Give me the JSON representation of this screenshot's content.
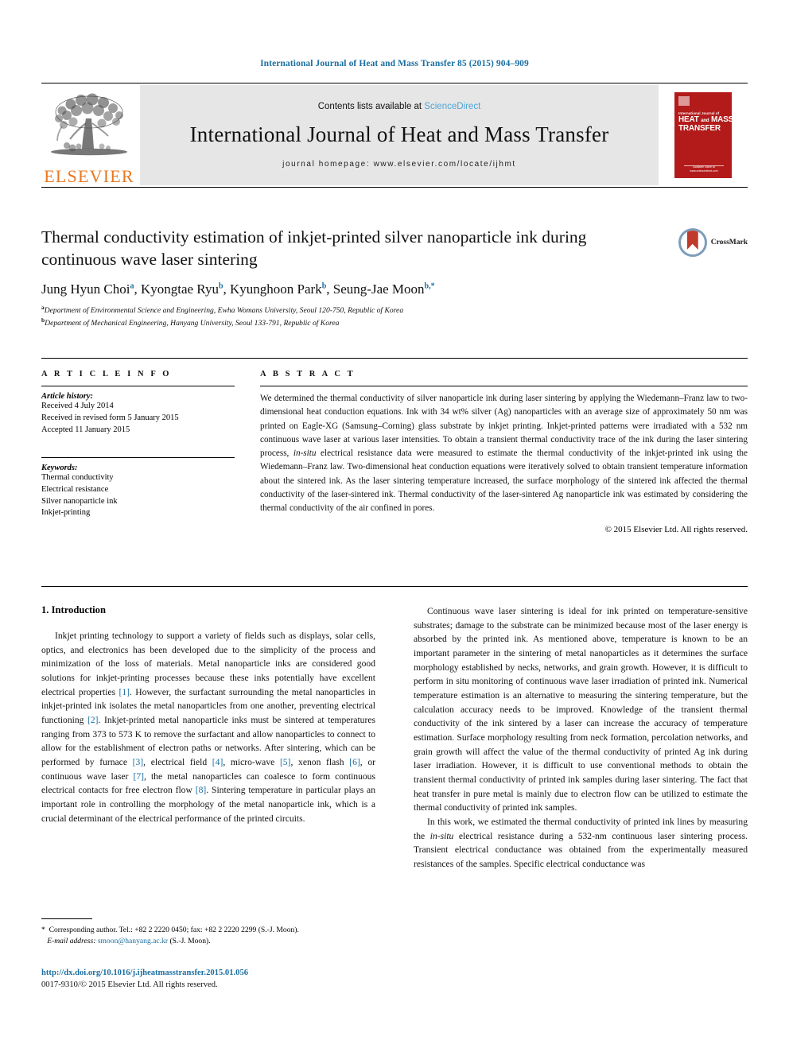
{
  "running_head": "International Journal of Heat and Mass Transfer 85 (2015) 904–909",
  "masthead": {
    "publisher": "ELSEVIER",
    "contents_prefix": "Contents lists available at ",
    "contents_link": "ScienceDirect",
    "journal_title": "International Journal of Heat and Mass Transfer",
    "homepage": "journal homepage: www.elsevier.com/locate/ijhmt",
    "cover": {
      "small_line": "International Journal of",
      "title_line1": "HEAT",
      "title_and": "and",
      "title_line2": "MASS",
      "title_line3": "TRANSFER",
      "foot_line": "Available online at www.sciencedirect.com"
    }
  },
  "article": {
    "title": "Thermal conductivity estimation of inkjet-printed silver nanoparticle ink during continuous wave laser sintering",
    "crossmark_label": "CrossMark",
    "authors": [
      {
        "name": "Jung Hyun Choi",
        "sup": "a",
        "sep": ", "
      },
      {
        "name": "Kyongtae Ryu",
        "sup": "b",
        "sep": ", "
      },
      {
        "name": "Kyunghoon Park",
        "sup": "b",
        "sep": ", "
      },
      {
        "name": "Seung-Jae Moon",
        "sup": "b,*",
        "sep": ""
      }
    ],
    "affiliations": [
      {
        "mark": "a",
        "text": "Department of Environmental Science and Engineering, Ewha Womans University, Seoul 120-750, Republic of Korea"
      },
      {
        "mark": "b",
        "text": "Department of Mechanical Engineering, Hanyang University, Seoul 133-791, Republic of Korea"
      }
    ]
  },
  "article_info": {
    "heading": "A R T I C L E    I N F O",
    "history_label": "Article history:",
    "history": [
      "Received 4 July 2014",
      "Received in revised form 5 January 2015",
      "Accepted 11 January 2015"
    ],
    "keywords_label": "Keywords:",
    "keywords": [
      "Thermal conductivity",
      "Electrical resistance",
      "Silver nanoparticle ink",
      "Inkjet-printing"
    ]
  },
  "abstract": {
    "heading": "A B S T R A C T",
    "text_part1": "We determined the thermal conductivity of silver nanoparticle ink during laser sintering by applying the Wiedemann–Franz law to two-dimensional heat conduction equations. Ink with 34 wt% silver (Ag) nanoparticles with an average size of approximately 50 nm was printed on Eagle-XG (Samsung–Corning) glass substrate by inkjet printing. Inkjet-printed patterns were irradiated with a 532 nm continuous wave laser at various laser intensities. To obtain a transient thermal conductivity trace of the ink during the laser sintering process, ",
    "italic1": "in-situ",
    "text_part2": " electrical resistance data were measured to estimate the thermal conductivity of the inkjet-printed ink using the Wiedemann–Franz law. Two-dimensional heat conduction equations were iteratively solved to obtain transient temperature information about the sintered ink. As the laser sintering temperature increased, the surface morphology of the sintered ink affected the thermal conductivity of the laser-sintered ink. Thermal conductivity of the laser-sintered Ag nanoparticle ink was estimated by considering the thermal conductivity of the air confined in pores.",
    "copyright": "© 2015 Elsevier Ltd. All rights reserved."
  },
  "introduction": {
    "heading": "1. Introduction",
    "left_paragraph_segments": [
      "Inkjet printing technology to support a variety of fields such as displays, solar cells, optics, and electronics has been developed due to the simplicity of the process and minimization of the loss of materials. Metal nanoparticle inks are considered good solutions for inkjet-printing processes because these inks potentially have excellent electrical properties ",
      "[1]",
      ". However, the surfactant surrounding the metal nanoparticles in inkjet-printed ink isolates the metal nanoparticles from one another, preventing electrical functioning ",
      "[2]",
      ". Inkjet-printed metal nanoparticle inks must be sintered at temperatures ranging from 373 to 573 K to remove the surfactant and allow nanoparticles to connect to allow for the establishment of electron paths or networks. After sintering, which can be performed by furnace ",
      "[3]",
      ", electrical field ",
      "[4]",
      ", micro-wave ",
      "[5]",
      ", xenon flash ",
      "[6]",
      ", or continuous wave laser ",
      "[7]",
      ", the metal nanoparticles can coalesce to form continuous electrical contacts for free electron flow ",
      "[8]",
      ". Sintering temperature in particular plays an important role in controlling the morphology of the metal nanoparticle ink, which is a crucial determinant of the electrical performance of the printed circuits."
    ],
    "right_paragraph_1": "Continuous wave laser sintering is ideal for ink printed on temperature-sensitive substrates; damage to the substrate can be minimized because most of the laser energy is absorbed by the printed ink. As mentioned above, temperature is known to be an important parameter in the sintering of metal nanoparticles as it determines the surface morphology established by necks, networks, and grain growth. However, it is difficult to perform in situ monitoring of continuous wave laser irradiation of printed ink. Numerical temperature estimation is an alternative to measuring the sintering temperature, but the calculation accuracy needs to be improved. Knowledge of the transient thermal conductivity of the ink sintered by a laser can increase the accuracy of temperature estimation. Surface morphology resulting from neck formation, percolation networks, and grain growth will affect the value of the thermal conductivity of printed Ag ink during laser irradiation. However, it is difficult to use conventional methods to obtain the transient thermal conductivity of printed ink samples during laser sintering. The fact that heat transfer in pure metal is mainly due to electron flow can be utilized to estimate the thermal conductivity of printed ink samples.",
    "right_paragraph_2_a": "In this work, we estimated the thermal conductivity of printed ink lines by measuring the ",
    "right_paragraph_2_italic": "in-situ",
    "right_paragraph_2_b": " electrical resistance during a 532-nm continuous laser sintering process. Transient electrical conductance was obtained from the experimentally measured resistances of the samples. Specific electrical conductance was"
  },
  "footnote": {
    "star": "*",
    "corresponding": "Corresponding author. Tel.: +82 2 2220 0450; fax: +82 2 2220 2299 (S.-J. Moon).",
    "email_label": "E-mail address:",
    "email": "smoon@hanyang.ac.kr",
    "email_suffix": " (S.-J. Moon)."
  },
  "footer": {
    "doi": "http://dx.doi.org/10.1016/j.ijheatmasstransfer.2015.01.056",
    "issn": "0017-9310/© 2015 Elsevier Ltd. All rights reserved."
  },
  "colors": {
    "link_blue": "#1a6ea0",
    "science_direct_blue": "#4da6d8",
    "elsevier_orange": "#E87722",
    "cover_red": "#b31b1b"
  }
}
